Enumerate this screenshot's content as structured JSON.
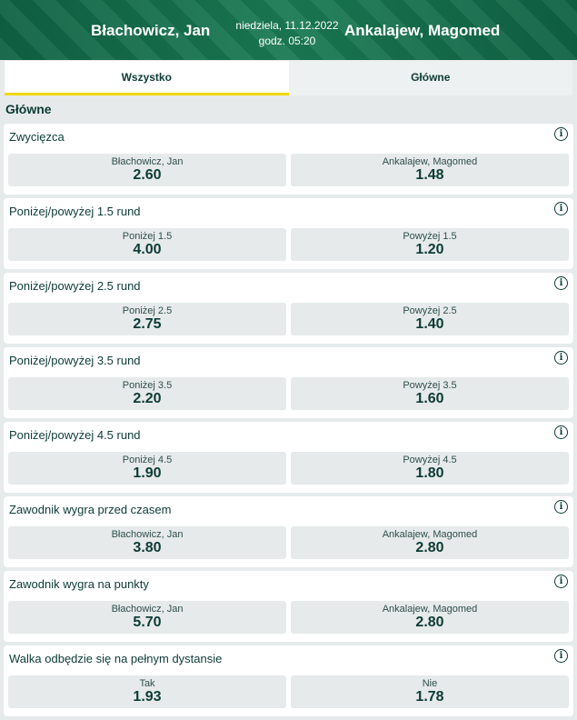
{
  "header": {
    "home": "Błachowicz, Jan",
    "away": "Ankalajew, Magomed",
    "date": "niedziela, 11.12.2022",
    "time": "godz. 05:20"
  },
  "tabs": [
    {
      "label": "Wszystko",
      "active": true
    },
    {
      "label": "Główne",
      "active": false
    }
  ],
  "section_title": "Główne",
  "markets": [
    {
      "title": "Zwycięzca",
      "outcomes": [
        {
          "label": "Błachowicz, Jan",
          "odds": "2.60"
        },
        {
          "label": "Ankalajew, Magomed",
          "odds": "1.48"
        }
      ]
    },
    {
      "title": "Poniżej/powyżej 1.5 rund",
      "outcomes": [
        {
          "label": "Poniżej 1.5",
          "odds": "4.00"
        },
        {
          "label": "Powyżej 1.5",
          "odds": "1.20"
        }
      ]
    },
    {
      "title": "Poniżej/powyżej 2.5 rund",
      "outcomes": [
        {
          "label": "Poniżej 2.5",
          "odds": "2.75"
        },
        {
          "label": "Powyżej 2.5",
          "odds": "1.40"
        }
      ]
    },
    {
      "title": "Poniżej/powyżej 3.5 rund",
      "outcomes": [
        {
          "label": "Poniżej 3.5",
          "odds": "2.20"
        },
        {
          "label": "Powyżej 3.5",
          "odds": "1.60"
        }
      ]
    },
    {
      "title": "Poniżej/powyżej 4.5 rund",
      "outcomes": [
        {
          "label": "Poniżej 4.5",
          "odds": "1.90"
        },
        {
          "label": "Powyżej 4.5",
          "odds": "1.80"
        }
      ]
    },
    {
      "title": "Zawodnik wygra przed czasem",
      "outcomes": [
        {
          "label": "Błachowicz, Jan",
          "odds": "3.80"
        },
        {
          "label": "Ankalajew, Magomed",
          "odds": "2.80"
        }
      ]
    },
    {
      "title": "Zawodnik wygra na punkty",
      "outcomes": [
        {
          "label": "Błachowicz, Jan",
          "odds": "5.70"
        },
        {
          "label": "Ankalajew, Magomed",
          "odds": "2.80"
        }
      ]
    },
    {
      "title": "Walka odbędzie się na pełnym dystansie",
      "outcomes": [
        {
          "label": "Tak",
          "odds": "1.93"
        },
        {
          "label": "Nie",
          "odds": "1.78"
        }
      ]
    }
  ],
  "icons": {
    "info": "info-icon"
  },
  "colors": {
    "header_green": "#146b4b",
    "tab_underline": "#f2d700",
    "text_dark": "#0d3b36"
  }
}
